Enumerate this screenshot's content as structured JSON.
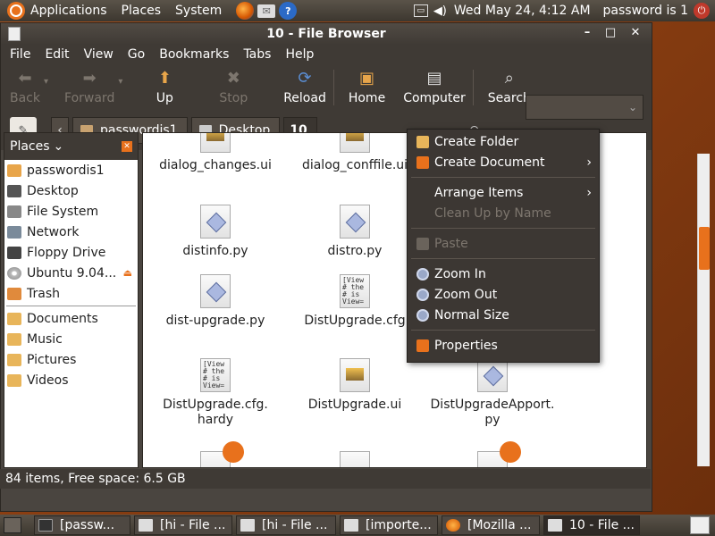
{
  "top_panel": {
    "menus": [
      "Applications",
      "Places",
      "System"
    ],
    "clock": "Wed May 24,  4:12 AM",
    "user": "password is 1"
  },
  "window": {
    "title": "10 - File Browser",
    "menubar": [
      "File",
      "Edit",
      "View",
      "Go",
      "Bookmarks",
      "Tabs",
      "Help"
    ],
    "toolbar": {
      "back": "Back",
      "forward": "Forward",
      "up": "Up",
      "stop": "Stop",
      "reload": "Reload",
      "home": "Home",
      "computer": "Computer",
      "search": "Search"
    },
    "path": [
      "passwordis1",
      "Desktop",
      "10"
    ],
    "status": "84 items, Free space: 6.5 GB"
  },
  "sidebar": {
    "title": "Places",
    "places": [
      "passwordis1",
      "Desktop",
      "File System",
      "Network",
      "Floppy Drive",
      "Ubuntu 9.04...",
      "Trash"
    ],
    "bookmarks": [
      "Documents",
      "Music",
      "Pictures",
      "Videos"
    ]
  },
  "files": [
    {
      "name": "dialog_changes.ui",
      "icon": "image-doc"
    },
    {
      "name": "dialog_conffile.ui",
      "icon": "image-doc"
    },
    {
      "name": "distinfo.py",
      "icon": "python-file"
    },
    {
      "name": "distro.py",
      "icon": "python-file"
    },
    {
      "name": "dist-upgrade.py",
      "icon": "python-file"
    },
    {
      "name": "DistUpgrade.cfg",
      "icon": "text-file"
    },
    {
      "name": "DistUpgrade.cfg.\nhardy",
      "icon": "text-file"
    },
    {
      "name": "DistUpgrade.ui",
      "icon": "image-doc"
    },
    {
      "name": "DistUpgradeApport.\npy",
      "icon": "python-file"
    }
  ],
  "text_preview": "[View\n# the\n# is\nView=",
  "context_menu": {
    "create_folder": "Create Folder",
    "create_document": "Create Document",
    "arrange_items": "Arrange Items",
    "clean_up": "Clean Up by Name",
    "paste": "Paste",
    "zoom_in": "Zoom In",
    "zoom_out": "Zoom Out",
    "normal_size": "Normal Size",
    "properties": "Properties"
  },
  "taskbar": [
    {
      "label": "[passw...",
      "icon": "terminal"
    },
    {
      "label": "[hi - File ...",
      "icon": "file-browser"
    },
    {
      "label": "[hi - File ...",
      "icon": "file-browser"
    },
    {
      "label": "[importe...",
      "icon": "file-browser"
    },
    {
      "label": "[Mozilla ...",
      "icon": "firefox"
    },
    {
      "label": "10 - File ...",
      "icon": "file-browser"
    }
  ],
  "colors": {
    "accent": "#e8711c",
    "panel": "#3f3a35"
  }
}
